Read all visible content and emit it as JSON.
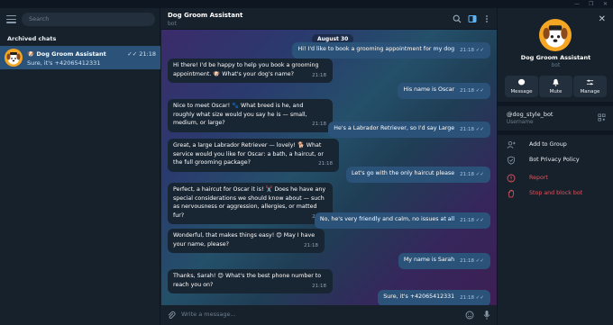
{
  "sidebar": {
    "search_placeholder": "Search",
    "section_title": "Archived chats",
    "chat": {
      "name": "Dog Groom Assistant",
      "preview": "Sure, it's +42065412331",
      "time": "21:18"
    }
  },
  "header": {
    "title": "Dog Groom Assistant",
    "subtitle": "bot"
  },
  "conversation": {
    "date_label": "August 30",
    "messages": [
      {
        "dir": "out",
        "text": "Hi! I'd like to book a grooming appointment for my dog",
        "time": "21:18"
      },
      {
        "dir": "in",
        "text": "Hi there! I'd be happy to help you book a grooming appointment. 🐶 What's your dog's name?",
        "time": "21:18"
      },
      {
        "dir": "out",
        "text": "His name is Oscar",
        "time": "21:18"
      },
      {
        "dir": "in",
        "text": "Nice to meet Oscar! 🐾 What breed is he, and roughly what size would you say he is — small, medium, or large?",
        "time": "21:18"
      },
      {
        "dir": "out",
        "text": "He's a Labrador Retriever, so I'd say Large",
        "time": "21:18"
      },
      {
        "dir": "in",
        "text": "Great, a large Labrador Retriever — lovely! 🐕 What service would you like for Oscar: a bath, a haircut, or the full grooming package?",
        "time": "21:18"
      },
      {
        "dir": "out",
        "text": "Let's go with the only haircut please",
        "time": "21:18"
      },
      {
        "dir": "in",
        "text": "Perfect, a haircut for Oscar it is! ✂️ Does he have any special considerations we should know about — such as nervousness or aggression, allergies, or matted fur?",
        "time": "21:18"
      },
      {
        "dir": "out",
        "text": "No, he's very friendly and calm, no issues at all",
        "time": "21:18"
      },
      {
        "dir": "in",
        "text": "Wonderful, that makes things easy! 😊 May I have your name, please?",
        "time": "21:18"
      },
      {
        "dir": "out",
        "text": "My name is Sarah",
        "time": "21:18"
      },
      {
        "dir": "in",
        "text": "Thanks, Sarah! 😊 What's the best phone number to reach you on?",
        "time": "21:18"
      },
      {
        "dir": "out",
        "text": "Sure, it's +42065412331",
        "time": "21:18"
      }
    ],
    "input_placeholder": "Write a message..."
  },
  "profile": {
    "name": "Dog Groom Assistant",
    "subtitle": "bot",
    "actions": [
      {
        "label": "Message",
        "icon": "message-icon"
      },
      {
        "label": "Mute",
        "icon": "bell-icon"
      },
      {
        "label": "Manage",
        "icon": "sliders-icon"
      }
    ],
    "username": "@dog_style_bot",
    "username_label": "Username",
    "rows": [
      {
        "label": "Add to Group",
        "icon": "add-user-icon"
      },
      {
        "label": "Bot Privacy Policy",
        "icon": "shield-icon"
      },
      {
        "label": "Report",
        "icon": "report-icon"
      },
      {
        "label": "Stop and block bot",
        "icon": "stop-hand-icon"
      }
    ]
  },
  "colors": {
    "outgoing_bubble": "#2b5278",
    "incoming_bubble": "#182533",
    "danger": "#e0535f",
    "accent": "#5eb5f7"
  }
}
